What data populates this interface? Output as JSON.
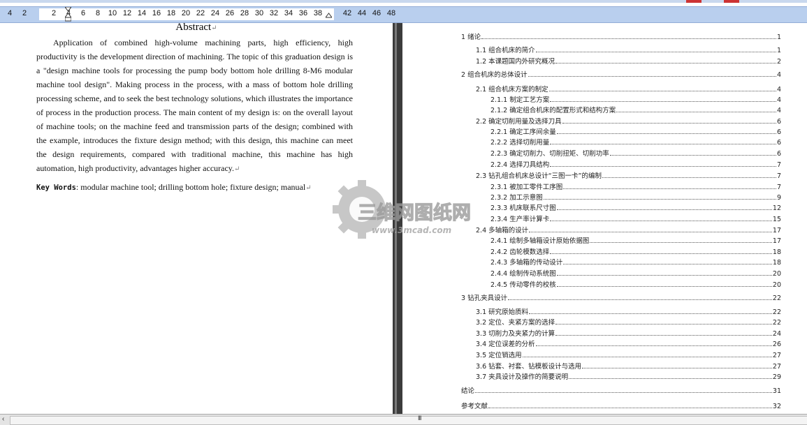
{
  "ruler": {
    "numbers": [
      "4",
      "2",
      "2",
      "4",
      "6",
      "8",
      "10",
      "12",
      "14",
      "16",
      "18",
      "20",
      "22",
      "24",
      "26",
      "28",
      "30",
      "32",
      "34",
      "36",
      "38",
      "42",
      "44",
      "46",
      "48"
    ]
  },
  "abstract": {
    "title": "Abstract",
    "body": "Application of combined high-volume machining parts, high efficiency, high productivity is the development direction of machining. The topic of this graduation design is a \"design machine tools for processing the pump body bottom hole drilling 8-M6 modular machine tool design\". Making process in the process, with a mass of bottom hole drilling processing scheme, and to seek the best technology solutions, which illustrates the importance of process in the production process. The main content of my design is: on the overall layout of machine tools; on the machine feed and transmission parts of the design; combined with the example, introduces the fixture design method; with this design, this machine can meet the design requirements, compared with traditional machine, this machine has high automation, high productivity, advantages higher accuracy.",
    "keywords_label": "Key Words",
    "keywords": "modular machine tool; drilling bottom hole; fixture design; manual"
  },
  "watermark": {
    "brand": "三维网图纸网",
    "url": "www.3mcad.com"
  },
  "toc": [
    {
      "text": "1  绪论",
      "page": "1"
    },
    {
      "text": "1.1  组合机床的简介",
      "page": "1"
    },
    {
      "text": "1.2 本课题国内外研究概况",
      "page": "2"
    },
    {
      "text": "2   组合机床的总体设计",
      "page": "4"
    },
    {
      "text": "2.1  组合机床方案的制定",
      "page": "4"
    },
    {
      "text": "2.1.1  制定工艺方案",
      "page": "4"
    },
    {
      "text": "2.1.2  确定组合机床的配置形式和结构方案",
      "page": "4"
    },
    {
      "text": "2.2  确定切削用量及选择刀具",
      "page": "6"
    },
    {
      "text": "2.2.1  确定工序间余量",
      "page": "6"
    },
    {
      "text": "2.2.2  选择切削用量",
      "page": "6"
    },
    {
      "text": "2.2.3  确定切削力、切削扭矩、切削功率",
      "page": "6"
    },
    {
      "text": "2.2.4  选择刀具结构",
      "page": "7"
    },
    {
      "text": "2.3  钻孔组合机床总设计“三图一卡”的编制",
      "page": "7"
    },
    {
      "text": "2.3.1  被加工零件工序图",
      "page": "7"
    },
    {
      "text": "2.3.2  加工示意图",
      "page": "9"
    },
    {
      "text": "2.3.3  机床联系尺寸图",
      "page": "12"
    },
    {
      "text": "2.3.4  生产率计算卡",
      "page": "15"
    },
    {
      "text": "2.4    多轴箱的设计",
      "page": "17"
    },
    {
      "text": "2.4.1  绘制多轴箱设计原始依据图",
      "page": "17"
    },
    {
      "text": "2.4.2  齿轮模数选择",
      "page": "18"
    },
    {
      "text": "2.4.3  多轴箱的传动设计",
      "page": "18"
    },
    {
      "text": "2.4.4  绘制传动系统图",
      "page": "20"
    },
    {
      "text": "2.4.5  传动零件的校核",
      "page": "20"
    },
    {
      "text": "3  钻孔夹具设计",
      "page": "22"
    },
    {
      "text": "3.1  研究原始质料",
      "page": "22"
    },
    {
      "text": "3.2  定位、夹紧方案的选择",
      "page": "22"
    },
    {
      "text": "3.3 切削力及夹紧力的计算",
      "page": "24"
    },
    {
      "text": "3.4 定位误差的分析",
      "page": "26"
    },
    {
      "text": "3.5  定位销选用",
      "page": "27"
    },
    {
      "text": "3.6  钻套、衬套、钻模板设计与选用",
      "page": "27"
    },
    {
      "text": "3.7 夹具设计及操作的简要说明",
      "page": "29"
    },
    {
      "text": "结论",
      "page": "31"
    },
    {
      "text": "参考文献",
      "page": "32"
    }
  ],
  "statusbar": {
    "grip": "III",
    "left_arrow": "‹"
  }
}
